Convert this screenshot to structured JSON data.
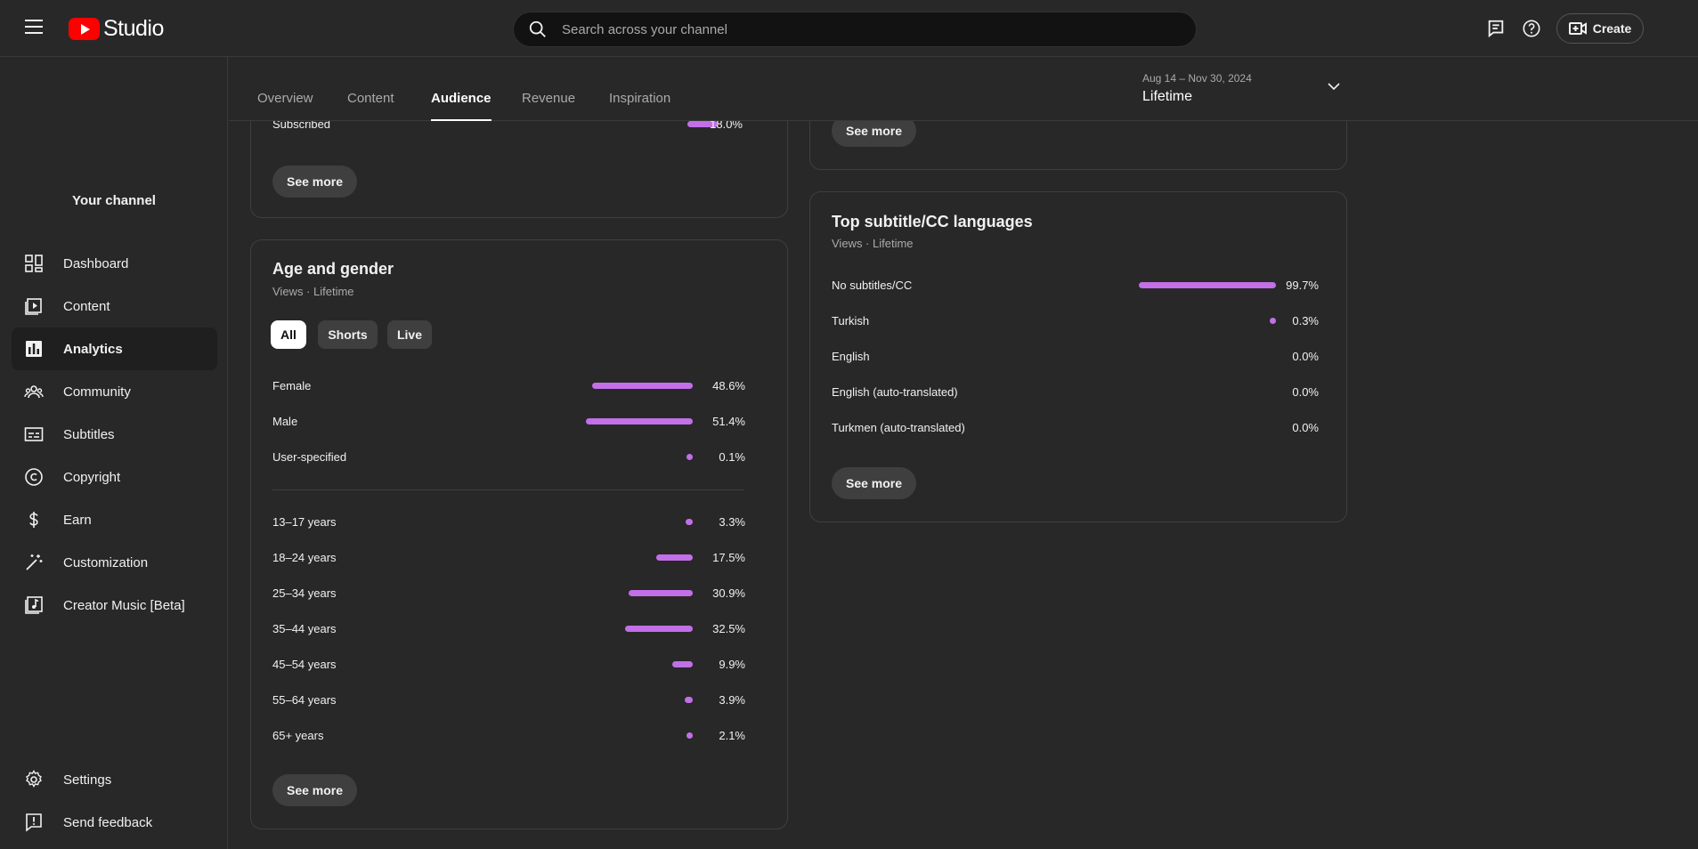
{
  "header": {
    "app_name": "Studio",
    "search_placeholder": "Search across your channel",
    "create_label": "Create"
  },
  "sidebar": {
    "channel_label": "Your channel",
    "items": [
      {
        "label": "Dashboard",
        "icon": "dashboard-icon"
      },
      {
        "label": "Content",
        "icon": "content-icon"
      },
      {
        "label": "Analytics",
        "icon": "analytics-icon",
        "active": true
      },
      {
        "label": "Community",
        "icon": "community-icon"
      },
      {
        "label": "Subtitles",
        "icon": "subtitles-icon"
      },
      {
        "label": "Copyright",
        "icon": "copyright-icon"
      },
      {
        "label": "Earn",
        "icon": "earn-icon"
      },
      {
        "label": "Customization",
        "icon": "customization-icon"
      },
      {
        "label": "Creator Music [Beta]",
        "icon": "creator-music-icon"
      }
    ],
    "bottom_items": [
      {
        "label": "Settings",
        "icon": "settings-icon"
      },
      {
        "label": "Send feedback",
        "icon": "feedback-icon"
      }
    ]
  },
  "tabs": [
    "Overview",
    "Content",
    "Audience",
    "Revenue",
    "Inspiration"
  ],
  "active_tab": "Audience",
  "date_range": {
    "range": "Aug 14 – Nov 30, 2024",
    "label": "Lifetime"
  },
  "accent_color": "#c26fe8",
  "subscription_card": {
    "row_label": "Subscribed",
    "row_value": "18.0%",
    "see_more": "See more"
  },
  "right_top_card": {
    "see_more": "See more"
  },
  "age_gender": {
    "title": "Age and gender",
    "subtitle": "Views · Lifetime",
    "chips": [
      "All",
      "Shorts",
      "Live"
    ],
    "active_chip": "All",
    "gender": [
      {
        "label": "Female",
        "value": "48.6%",
        "pct": 48.6
      },
      {
        "label": "Male",
        "value": "51.4%",
        "pct": 51.4
      },
      {
        "label": "User-specified",
        "value": "0.1%",
        "pct": 0.1
      }
    ],
    "ages": [
      {
        "label": "13–17 years",
        "value": "3.3%",
        "pct": 3.3
      },
      {
        "label": "18–24 years",
        "value": "17.5%",
        "pct": 17.5
      },
      {
        "label": "25–34 years",
        "value": "30.9%",
        "pct": 30.9
      },
      {
        "label": "35–44 years",
        "value": "32.5%",
        "pct": 32.5
      },
      {
        "label": "45–54 years",
        "value": "9.9%",
        "pct": 9.9
      },
      {
        "label": "55–64 years",
        "value": "3.9%",
        "pct": 3.9
      },
      {
        "label": "65+ years",
        "value": "2.1%",
        "pct": 2.1
      }
    ],
    "see_more": "See more"
  },
  "subtitle_languages": {
    "title": "Top subtitle/CC languages",
    "subtitle": "Views · Lifetime",
    "rows": [
      {
        "label": "No subtitles/CC",
        "value": "99.7%",
        "pct": 99.7
      },
      {
        "label": "Turkish",
        "value": "0.3%",
        "pct": 0.3
      },
      {
        "label": "English",
        "value": "0.0%",
        "pct": 0
      },
      {
        "label": "English (auto-translated)",
        "value": "0.0%",
        "pct": 0
      },
      {
        "label": "Turkmen (auto-translated)",
        "value": "0.0%",
        "pct": 0
      }
    ],
    "see_more": "See more"
  }
}
